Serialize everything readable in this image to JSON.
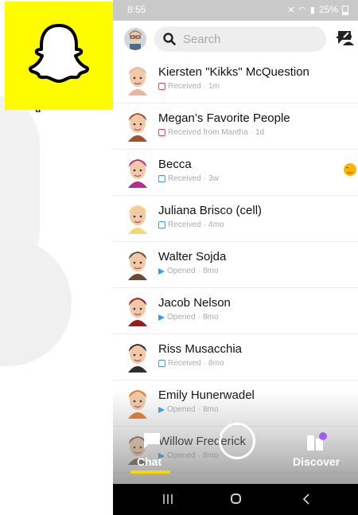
{
  "status_bar": {
    "time": "8:55",
    "battery": "25%"
  },
  "search": {
    "placeholder": "Search"
  },
  "chats": [
    {
      "name": "Kiersten \"Kikks\" McQuestion",
      "status": "Received",
      "time": "1m",
      "marker": "red",
      "avatar_color": "#e9b4a0"
    },
    {
      "name": "Megan’s Favorite People",
      "status": "Received from Mantha",
      "time": "1d",
      "marker": "red",
      "avatar_color": "#a0522d"
    },
    {
      "name": "Becca",
      "status": "Received",
      "time": "3w",
      "marker": "blue",
      "avatar_color": "#b52f8a",
      "emoji": "smiling-face"
    },
    {
      "name": "Juliana Brisco (cell)",
      "status": "Received",
      "time": "4mo",
      "marker": "blue",
      "avatar_color": "#f7d774"
    },
    {
      "name": "Walter Sojda",
      "status": "Opened",
      "time": "8mo",
      "marker": "arrow",
      "avatar_color": "#6b4a34"
    },
    {
      "name": "Jacob Nelson",
      "status": "Opened",
      "time": "8mo",
      "marker": "arrow",
      "avatar_color": "#9b1c1c"
    },
    {
      "name": "Riss Musacchia",
      "status": "Received",
      "time": "8mo",
      "marker": "blue",
      "avatar_color": "#2e2e2e"
    },
    {
      "name": "Emily Hunerwadel",
      "status": "Opened",
      "time": "8mo",
      "marker": "arrow",
      "avatar_color": "#e8731f"
    },
    {
      "name": "Willow Frederick",
      "status": "Opened",
      "time": "8mo",
      "marker": "arrow",
      "avatar_color": "#7a5a44"
    }
  ],
  "bottom_nav": {
    "chat_label": "Chat",
    "discover_label": "Discover"
  },
  "left_panel": {
    "letter": "u"
  },
  "colors": {
    "snap_yellow": "#fffc00",
    "red_marker": "#f23c57",
    "blue_marker": "#2fa3e6",
    "chat_underline": "#ffd500",
    "discover_dot": "#a05cff"
  }
}
